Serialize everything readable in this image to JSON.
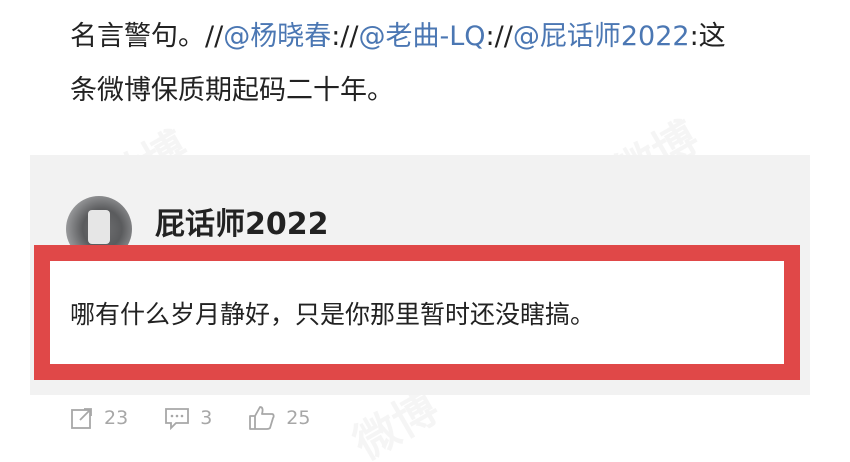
{
  "post": {
    "line1_prefix": "名言警句。//",
    "mention1": "@杨晓春",
    "sep1": "://",
    "mention2": "@老曲-LQ",
    "sep2": "://",
    "mention3": "@屁话师2022",
    "line1_suffix": ":这",
    "line2": "条微博保质期起码二十年。"
  },
  "repost": {
    "author_name": "屁话师2022",
    "comment": "哪有什么岁月静好，只是你那里暂时还没瞎搞。"
  },
  "actions": {
    "share_count": "23",
    "comment_count": "3",
    "like_count": "25"
  },
  "colors": {
    "mention": "#4b77b3",
    "highlight_border": "#e04848",
    "panel_background": "#f2f2f2",
    "action_gray": "#a7a7a7"
  },
  "icons": [
    "share-icon",
    "comment-icon",
    "like-icon"
  ]
}
